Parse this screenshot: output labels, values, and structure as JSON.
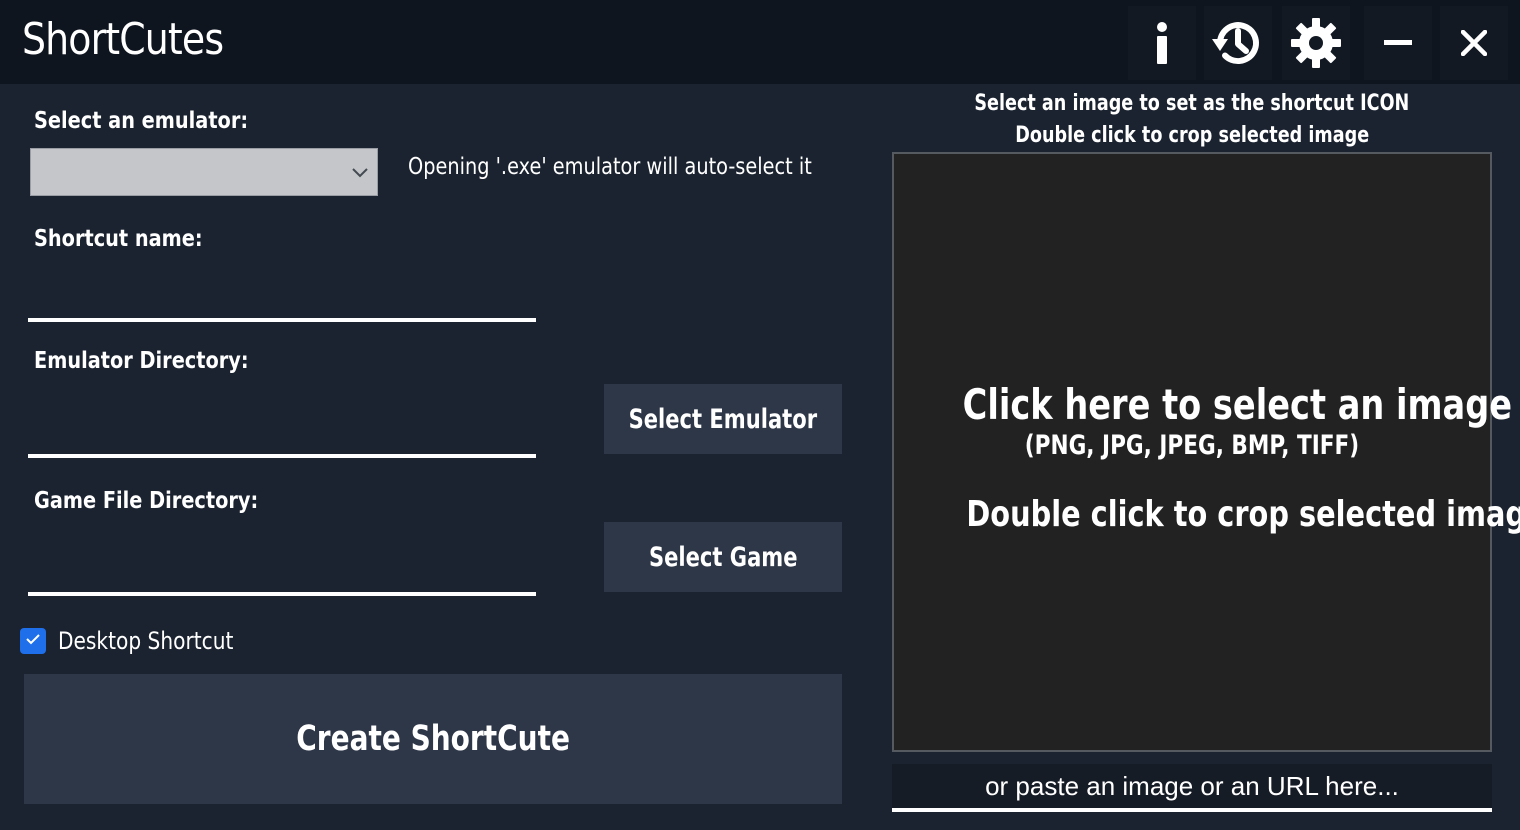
{
  "window": {
    "title": "ShortCutes",
    "buttons": {
      "info_icon": "info-icon",
      "history_icon": "history-icon",
      "settings_icon": "gear-icon",
      "minimize_icon": "minimize-icon",
      "close_icon": "close-icon"
    }
  },
  "form": {
    "emulator_label": "Select an emulator:",
    "emulator_selected": "",
    "emulator_hint": "Opening '.exe' emulator will auto-select it",
    "shortcut_name_label": "Shortcut name:",
    "shortcut_name_value": "",
    "emulator_dir_label": "Emulator Directory:",
    "emulator_dir_value": "",
    "select_emulator_button": "Select Emulator",
    "game_dir_label": "Game File Directory:",
    "game_dir_value": "",
    "select_game_button": "Select Game",
    "desktop_shortcut_label": "Desktop Shortcut",
    "desktop_shortcut_checked": true,
    "create_button": "Create ShortCute"
  },
  "image_panel": {
    "header_line1": "Select an  image to set as the shortcut ICON",
    "header_line2": "Double click to crop selected image",
    "drop_line1": "Click here to select an image",
    "drop_line2": "(PNG, JPG, JPEG, BMP, TIFF)",
    "drop_line3": "Double click to crop selected image",
    "url_placeholder": "or paste an image or an URL here..."
  },
  "colors": {
    "background": "#1b2330",
    "titlebar": "#0f151f",
    "button": "#2e3748",
    "image_area": "#222222",
    "checkbox_accent": "#1f6feb",
    "select_bg": "#c4c6c9"
  }
}
